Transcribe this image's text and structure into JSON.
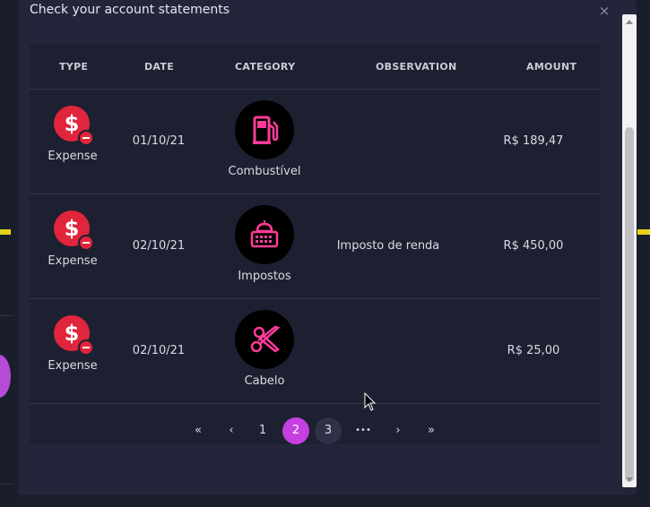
{
  "modal": {
    "title": "Check your account statements",
    "close": "×"
  },
  "table": {
    "headers": {
      "type": "TYPE",
      "date": "DATE",
      "category": "CATEGORY",
      "observation": "OBSERVATION",
      "amount": "AMOUNT"
    },
    "rows": [
      {
        "type": "Expense",
        "type_symbol": "$",
        "date": "01/10/21",
        "category": "Combustível",
        "category_icon": "fuel-pump-icon",
        "observation": "",
        "amount": "R$ 189,47"
      },
      {
        "type": "Expense",
        "type_symbol": "$",
        "date": "02/10/21",
        "category": "Impostos",
        "category_icon": "government-building-icon",
        "observation": "Imposto de renda",
        "amount": "R$ 450,00"
      },
      {
        "type": "Expense",
        "type_symbol": "$",
        "date": "02/10/21",
        "category": "Cabelo",
        "category_icon": "scissors-icon",
        "observation": "",
        "amount": "R$ 25,00"
      }
    ]
  },
  "pagination": {
    "first": "«",
    "prev": "‹",
    "pages": [
      "1",
      "2",
      "3"
    ],
    "current": "2",
    "ellipsis": "•••",
    "next": "›",
    "last": "»"
  },
  "colors": {
    "expense": "#e0253c",
    "accent": "#c63fe0",
    "category_icon": "#ff3c9a",
    "background": "#23263a"
  }
}
